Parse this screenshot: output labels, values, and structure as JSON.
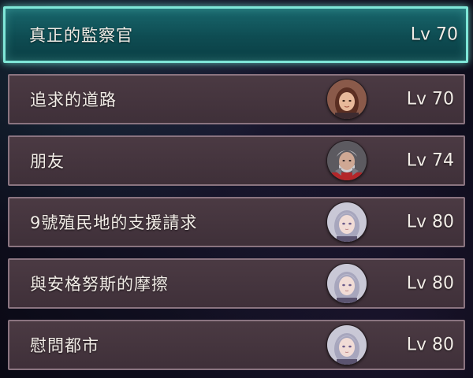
{
  "quests": [
    {
      "title": "真正的監察官",
      "level": "Lv 70",
      "selected": true,
      "avatar": null
    },
    {
      "title": "追求的道路",
      "level": "Lv 70",
      "selected": false,
      "avatar": "brown-haired-woman-portrait-icon"
    },
    {
      "title": "朋友",
      "level": "Lv 74",
      "selected": false,
      "avatar": "armored-gray-haired-man-portrait-icon"
    },
    {
      "title": "9號殖民地的支援請求",
      "level": "Lv 80",
      "selected": false,
      "avatar": "silver-haired-woman-portrait-icon"
    },
    {
      "title": "與安格努斯的摩擦",
      "level": "Lv 80",
      "selected": false,
      "avatar": "silver-haired-woman-portrait-icon"
    },
    {
      "title": "慰問都市",
      "level": "Lv 80",
      "selected": false,
      "avatar": "silver-haired-woman-portrait-icon"
    }
  ],
  "colors": {
    "selected_fill": "#0e4c52",
    "selected_border": "#7fe7d8",
    "row_fill": "#463640",
    "row_border": "#8a7480",
    "text": "#f1ece6"
  }
}
